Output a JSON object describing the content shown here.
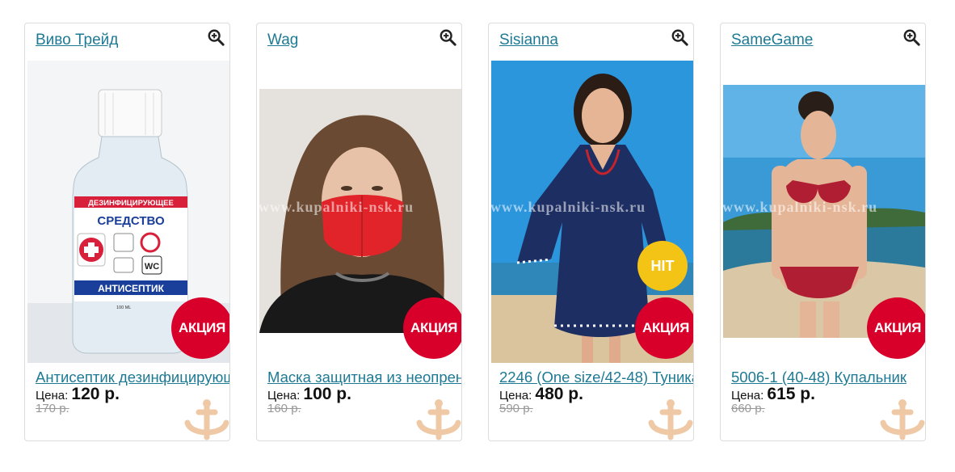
{
  "icons": {
    "zoom": "zoom-in-icon",
    "anchor": "anchor-watermark-icon"
  },
  "colors": {
    "link": "#1e7a94",
    "sale_badge": "#d8002a",
    "hit_badge": "#f3c315"
  },
  "products": [
    {
      "brand": "Виво Трейд",
      "title": "Антисептик дезинфицирующее средство",
      "price_label": "Цена:",
      "price": "120 р.",
      "old_price": "170 р.",
      "badges": [
        "АКЦИЯ"
      ],
      "watermark": ""
    },
    {
      "brand": "Wag",
      "title": "Маска защитная из неопрена",
      "price_label": "Цена:",
      "price": "100 р.",
      "old_price": "160 р.",
      "badges": [
        "АКЦИЯ"
      ],
      "watermark": "www.kupalniki-nsk.ru"
    },
    {
      "brand": "Sisianna",
      "title": "2246 (One size/42-48) Туника",
      "price_label": "Цена:",
      "price": "480 р.",
      "old_price": "590 р.",
      "badges": [
        "HIT",
        "АКЦИЯ"
      ],
      "watermark": "www.kupalniki-nsk.ru"
    },
    {
      "brand": "SameGame",
      "title": "5006-1 (40-48) Купальник",
      "price_label": "Цена:",
      "price": "615 р.",
      "old_price": "660 р.",
      "badges": [
        "АКЦИЯ"
      ],
      "watermark": "www.kupalniki-nsk.ru"
    }
  ],
  "product_image_text": {
    "label_top": "ДЕЗИНФИЦИРУЮЩЕЕ",
    "label_main": "СРЕДСТВО",
    "label_bottom": "АНТИСЕПТИК",
    "wc": "WC",
    "volume": "100 ML"
  }
}
